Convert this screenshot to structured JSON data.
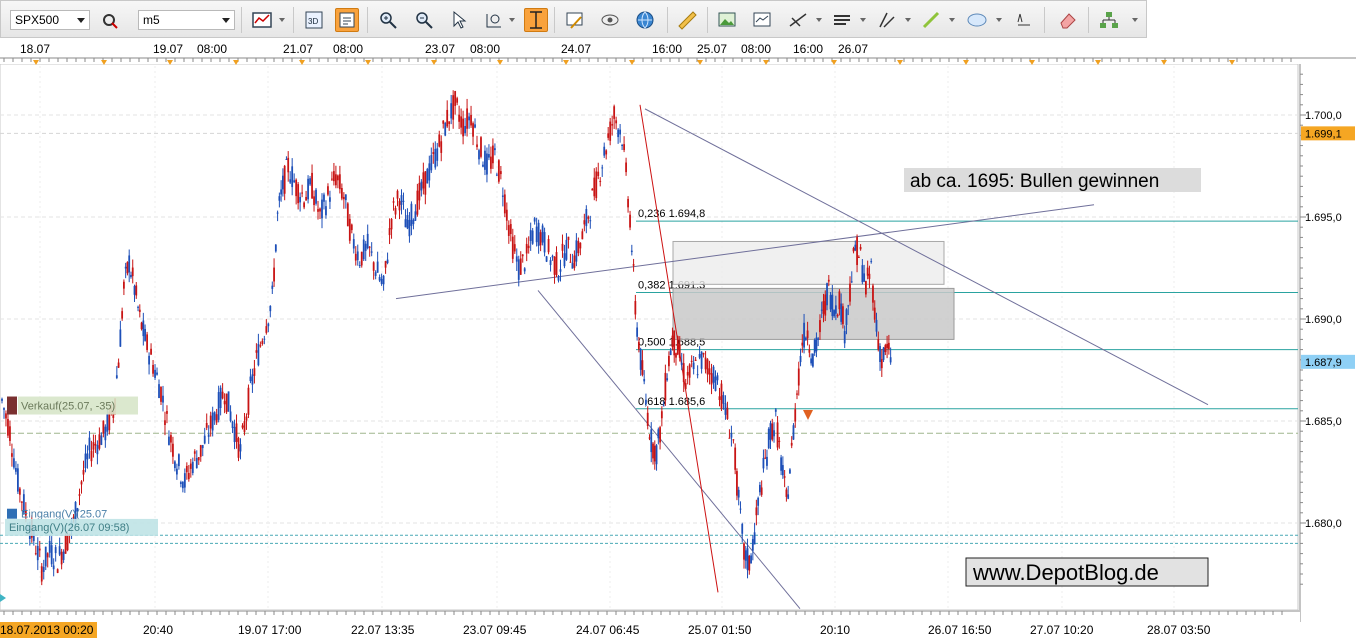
{
  "toolbar": {
    "symbol": "SPX500",
    "timeframe": "m5",
    "icons": [
      "chart-type-icon",
      "3d-icon",
      "indicator-icon",
      "zoom-in-icon",
      "zoom-out-icon",
      "cursor-icon",
      "zoom-region-icon",
      "crosshair-icon",
      "notes-icon",
      "eye-icon",
      "globe-icon",
      "ruler-icon",
      "image-icon",
      "template-icon",
      "trendline-icon",
      "horizontal-line-icon",
      "channel-icon",
      "pencil-icon",
      "ellipse-icon",
      "text-label-icon",
      "eraser-icon",
      "hierarchy-icon"
    ]
  },
  "chart_data": {
    "type": "candlestick",
    "symbol": "SPX500",
    "interval": "m5",
    "ylim": [
      1676.0,
      1702.5
    ],
    "y_ticks": [
      "1.680,0",
      "1.685,0",
      "1.690,0",
      "1.695,0",
      "1.700,0"
    ],
    "last_price_labels": [
      "1.699,1",
      "1.687,9"
    ],
    "top_date_ticks": [
      "18.07",
      "19.07",
      "08:00",
      "21.07",
      "08:00",
      "23.07",
      "08:00",
      "24.07",
      "16:00",
      "25.07",
      "08:00",
      "16:00",
      "26.07"
    ],
    "bottom_time_ticks": [
      "18.07.2013 00:20",
      "20:40",
      "19.07 17:00",
      "22.07 13:35",
      "23.07 09:45",
      "24.07 06:45",
      "25.07 01:50",
      "20:10",
      "26.07 16:50",
      "27.07 10:20",
      "28.07 03:50"
    ],
    "fibonacci": [
      {
        "label": "0,236 1.694,8",
        "price": 1694.8
      },
      {
        "label": "0,382 1.691,3",
        "price": 1691.3
      },
      {
        "label": "0,500 1.688,5",
        "price": 1688.5
      },
      {
        "label": "0,618 1.685,6",
        "price": 1685.6
      }
    ],
    "annotations": {
      "headline": "ab ca. 1695: Bullen gewinnen",
      "watermark": "www.DepotBlog.de",
      "order_sell": "Verkauf(25.07, -35)",
      "order_buy_a": "Eingang(V)(25.07",
      "order_buy_b": "Eingang(V)(26.07 09:58)"
    },
    "price_path": [
      [
        0,
        1686.0
      ],
      [
        0.6,
        1684.5
      ],
      [
        1.2,
        1682.0
      ],
      [
        1.8,
        1680.5
      ],
      [
        2.4,
        1679.2
      ],
      [
        3,
        1677.8
      ],
      [
        3.6,
        1678.6
      ],
      [
        4.2,
        1678.2
      ],
      [
        4.8,
        1679.0
      ],
      [
        5.4,
        1680.0
      ],
      [
        6,
        1682.0
      ],
      [
        6.6,
        1683.5
      ],
      [
        7.2,
        1684.0
      ],
      [
        7.8,
        1684.5
      ],
      [
        8.4,
        1685.5
      ],
      [
        8.8,
        1688.0
      ],
      [
        9.2,
        1691.5
      ],
      [
        9.6,
        1692.8
      ],
      [
        10,
        1691.5
      ],
      [
        10.4,
        1690.0
      ],
      [
        10.8,
        1689.0
      ],
      [
        11.4,
        1687.8
      ],
      [
        12,
        1686.5
      ],
      [
        12.6,
        1684.5
      ],
      [
        13.2,
        1683.0
      ],
      [
        13.8,
        1682.0
      ],
      [
        14.4,
        1683.0
      ],
      [
        15,
        1683.5
      ],
      [
        15.6,
        1684.5
      ],
      [
        16.2,
        1685.5
      ],
      [
        16.8,
        1686.5
      ],
      [
        17.4,
        1685.0
      ],
      [
        18,
        1683.5
      ],
      [
        18.6,
        1686.0
      ],
      [
        19.2,
        1688.0
      ],
      [
        19.8,
        1689.5
      ],
      [
        20.4,
        1691.0
      ],
      [
        20.8,
        1695.0
      ],
      [
        21.2,
        1696.5
      ],
      [
        21.6,
        1697.5
      ],
      [
        22.2,
        1696.5
      ],
      [
        22.8,
        1696.0
      ],
      [
        23.4,
        1696.5
      ],
      [
        24,
        1695.0
      ],
      [
        24.6,
        1696.0
      ],
      [
        25.2,
        1697.0
      ],
      [
        25.8,
        1696.0
      ],
      [
        26.4,
        1694.0
      ],
      [
        27,
        1693.0
      ],
      [
        27.6,
        1693.5
      ],
      [
        28.2,
        1692.5
      ],
      [
        28.8,
        1691.5
      ],
      [
        29.4,
        1695.0
      ],
      [
        30,
        1696.0
      ],
      [
        30.6,
        1694.5
      ],
      [
        31.2,
        1695.5
      ],
      [
        31.8,
        1696.5
      ],
      [
        32.4,
        1697.5
      ],
      [
        33,
        1698.5
      ],
      [
        33.6,
        1699.8
      ],
      [
        34.2,
        1700.5
      ],
      [
        34.8,
        1699.5
      ],
      [
        35.4,
        1700.0
      ],
      [
        36,
        1698.5
      ],
      [
        36.6,
        1697.5
      ],
      [
        37.2,
        1698.0
      ],
      [
        37.8,
        1696.5
      ],
      [
        38.4,
        1694.0
      ],
      [
        39,
        1692.5
      ],
      [
        39.6,
        1693.0
      ],
      [
        40.2,
        1694.5
      ],
      [
        40.8,
        1694.0
      ],
      [
        41.4,
        1693.0
      ],
      [
        42,
        1692.5
      ],
      [
        42.6,
        1693.5
      ],
      [
        43.2,
        1693.0
      ],
      [
        43.8,
        1694.0
      ],
      [
        44.4,
        1695.5
      ],
      [
        45,
        1697.0
      ],
      [
        45.6,
        1698.5
      ],
      [
        46.2,
        1700.0
      ],
      [
        46.8,
        1699.0
      ],
      [
        47.4,
        1695.0
      ],
      [
        47.8,
        1690.5
      ],
      [
        48.2,
        1688.0
      ],
      [
        48.6,
        1686.0
      ],
      [
        49,
        1684.0
      ],
      [
        49.4,
        1683.5
      ],
      [
        49.8,
        1685.0
      ],
      [
        50.2,
        1687.5
      ],
      [
        50.6,
        1689.0
      ],
      [
        51,
        1688.5
      ],
      [
        51.6,
        1687.0
      ],
      [
        52.2,
        1687.5
      ],
      [
        52.8,
        1688.0
      ],
      [
        53.4,
        1687.5
      ],
      [
        54,
        1687.0
      ],
      [
        54.6,
        1685.5
      ],
      [
        55.2,
        1684.0
      ],
      [
        55.6,
        1681.0
      ],
      [
        56,
        1678.5
      ],
      [
        56.4,
        1678.0
      ],
      [
        56.8,
        1679.5
      ],
      [
        57.2,
        1681.5
      ],
      [
        57.6,
        1683.0
      ],
      [
        58,
        1684.5
      ],
      [
        58.4,
        1685.0
      ],
      [
        58.8,
        1683.0
      ],
      [
        59.2,
        1681.0
      ],
      [
        59.6,
        1683.5
      ],
      [
        60,
        1686.5
      ],
      [
        60.4,
        1689.0
      ],
      [
        60.8,
        1689.5
      ],
      [
        61.2,
        1688.0
      ],
      [
        61.6,
        1689.0
      ],
      [
        62,
        1690.5
      ],
      [
        62.4,
        1691.5
      ],
      [
        62.8,
        1690.5
      ],
      [
        63.2,
        1691.0
      ],
      [
        63.6,
        1689.5
      ],
      [
        64,
        1691.5
      ],
      [
        64.4,
        1693.5
      ],
      [
        64.8,
        1693.0
      ],
      [
        65.2,
        1691.5
      ],
      [
        65.6,
        1692.5
      ],
      [
        66,
        1689.5
      ],
      [
        66.4,
        1688.0
      ],
      [
        66.8,
        1688.5
      ],
      [
        67.2,
        1687.9
      ]
    ]
  }
}
